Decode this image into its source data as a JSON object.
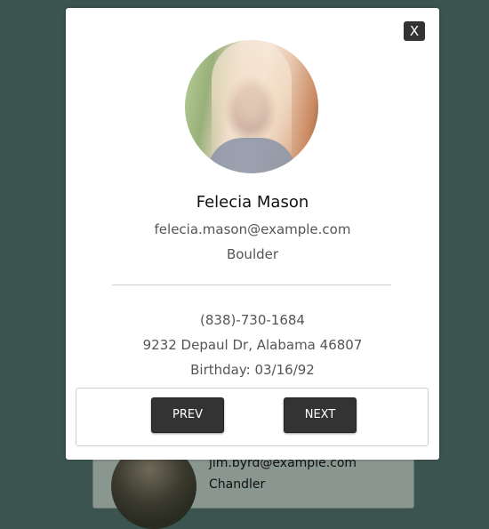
{
  "background_card": {
    "email": "jim.byrd@example.com",
    "city": "Chandler"
  },
  "modal": {
    "close_label": "X",
    "name": "Felecia Mason",
    "email": "felecia.mason@example.com",
    "city": "Boulder",
    "phone": "(838)-730-1684",
    "address": "9232 Depaul Dr, Alabama 46807",
    "birthday": "Birthday: 03/16/92",
    "prev_label": "PREV",
    "next_label": "NEXT"
  },
  "colors": {
    "backdrop": "#3b5450",
    "button": "#333333"
  }
}
